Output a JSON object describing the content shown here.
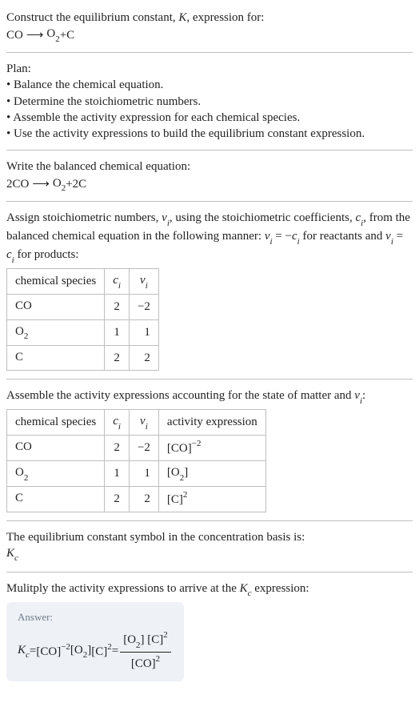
{
  "header": {
    "prompt": "Construct the equilibrium constant, ",
    "Kvar": "K",
    "prompt2": ", expression for:",
    "eq_lhs": "CO",
    "eq_arrow": "⟶",
    "eq_rhs_a": "O",
    "eq_rhs_a_sub": "2",
    "eq_plus": " + ",
    "eq_rhs_b": "C"
  },
  "plan": {
    "title": "Plan:",
    "items": [
      "Balance the chemical equation.",
      "Determine the stoichiometric numbers.",
      "Assemble the activity expression for each chemical species.",
      "Use the activity expressions to build the equilibrium constant expression."
    ]
  },
  "balanced": {
    "intro": "Write the balanced chemical equation:",
    "lhs_coef": "2 ",
    "lhs": "CO",
    "arrow": "⟶",
    "rhs_a": "O",
    "rhs_a_sub": "2",
    "plus": " + ",
    "rhs_b_coef": "2 ",
    "rhs_b": "C"
  },
  "stoich": {
    "intro_a": "Assign stoichiometric numbers, ",
    "nu": "ν",
    "sub_i": "i",
    "intro_b": ", using the stoichiometric coefficients, ",
    "c": "c",
    "intro_c": ", from the balanced chemical equation in the following manner: ",
    "rel1_a": "ν",
    "rel1_eq": " = −",
    "rel1_b": "c",
    "intro_d": " for reactants and ",
    "rel2_eq": " = ",
    "intro_e": " for products:",
    "headers": {
      "species": "chemical species",
      "ci": "c",
      "nui": "ν"
    },
    "rows": [
      {
        "species_a": "CO",
        "species_sub": "",
        "ci": "2",
        "nui": "−2"
      },
      {
        "species_a": "O",
        "species_sub": "2",
        "ci": "1",
        "nui": "1"
      },
      {
        "species_a": "C",
        "species_sub": "",
        "ci": "2",
        "nui": "2"
      }
    ]
  },
  "activity": {
    "intro_a": "Assemble the activity expressions accounting for the state of matter and ",
    "intro_b": ":",
    "headers": {
      "species": "chemical species",
      "ci": "c",
      "nui": "ν",
      "act": "activity expression"
    },
    "rows": [
      {
        "species_a": "CO",
        "species_sub": "",
        "ci": "2",
        "nui": "−2",
        "act_base": "[CO]",
        "act_sup": "−2",
        "act_sub": ""
      },
      {
        "species_a": "O",
        "species_sub": "2",
        "ci": "1",
        "nui": "1",
        "act_base": "[O",
        "act_sub": "2",
        "act_close": "]",
        "act_sup": ""
      },
      {
        "species_a": "C",
        "species_sub": "",
        "ci": "2",
        "nui": "2",
        "act_base": "[C]",
        "act_sup": "2",
        "act_sub": ""
      }
    ]
  },
  "kcsymbol": {
    "intro": "The equilibrium constant symbol in the concentration basis is:",
    "K": "K",
    "c": "c"
  },
  "multiply": {
    "intro_a": "Mulitply the activity expressions to arrive at the ",
    "K": "K",
    "c": "c",
    "intro_b": " expression:"
  },
  "answer": {
    "label": "Answer:",
    "K": "K",
    "c": "c",
    "eq": " = ",
    "t1_base": "[CO]",
    "t1_sup": "−2",
    "sp": " ",
    "t2_open": "[O",
    "t2_sub": "2",
    "t2_close": "]",
    "t3_base": "[C]",
    "t3_sup": "2",
    "eq2": " = ",
    "num_a_open": "[O",
    "num_a_sub": "2",
    "num_a_close": "]",
    "num_b_base": "[C]",
    "num_b_sup": "2",
    "den_base": "[CO]",
    "den_sup": "2"
  }
}
